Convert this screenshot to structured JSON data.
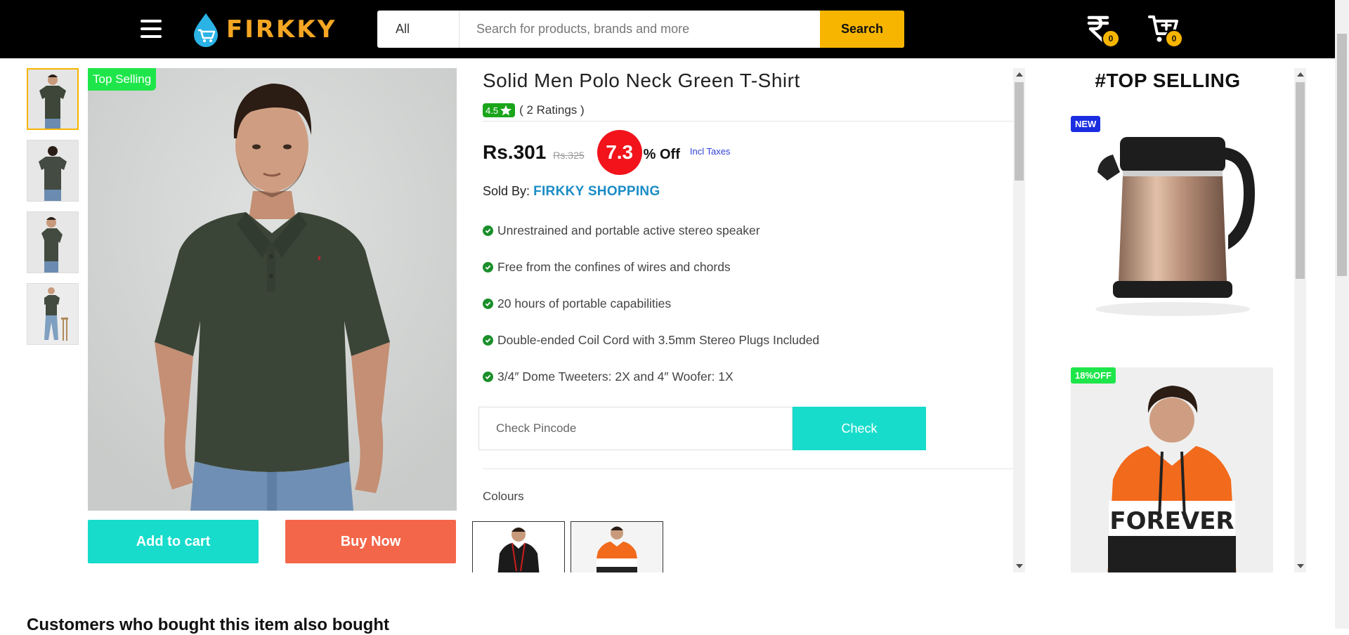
{
  "header": {
    "logo_text": "FIRKKY",
    "search": {
      "category": "All",
      "placeholder": "Search for products, brands and more",
      "button_label": "Search"
    },
    "wallet_count": "0",
    "cart_count": "0"
  },
  "product": {
    "tag": "Top Selling",
    "title": "Solid Men Polo Neck Green T-Shirt",
    "rating": "4.5",
    "ratings_text": "( 2 Ratings )",
    "price": "Rs.301",
    "mrp": "Rs.325",
    "discount": "7.3",
    "off_label": "% Off",
    "tax_note": "Incl Taxes",
    "sold_by_label": "Sold By:",
    "seller": "FIRKKY SHOPPING",
    "features": [
      "Unrestrained and portable active stereo speaker",
      "Free from the confines of wires and chords",
      "20 hours of portable capabilities",
      "Double-ended Coil Cord with 3.5mm Stereo Plugs Included",
      "3/4″ Dome Tweeters: 2X and 4″ Woofer: 1X"
    ],
    "pincode_placeholder": "Check Pincode",
    "check_label": "Check",
    "colours_label": "Colours",
    "add_to_cart": "Add to cart",
    "buy_now": "Buy Now"
  },
  "sidebar": {
    "title": "#TOP SELLING",
    "items": [
      {
        "badge": "NEW",
        "badge_color": "#1b2de0"
      },
      {
        "badge": "18%OFF",
        "badge_color": "#1ee64a"
      }
    ]
  },
  "bottom": {
    "heading": "Customers who bought this item also bought"
  },
  "colors": {
    "header_bg": "#000000",
    "accent_yellow": "#f7b500",
    "teal": "#17dccb",
    "buy_orange": "#f4664a",
    "discount_red": "#f2131b",
    "seller_blue": "#1b8cc6"
  }
}
